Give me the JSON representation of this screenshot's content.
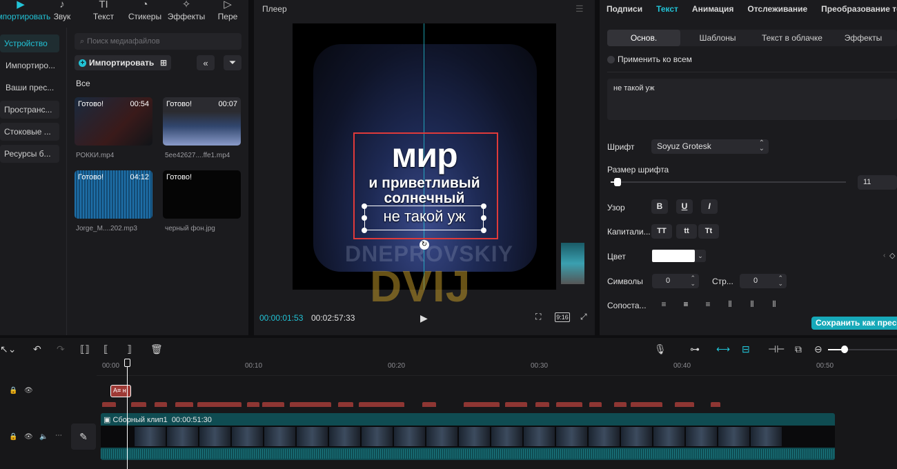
{
  "media_panel": {
    "categories": [
      {
        "label": "Импортировать",
        "icon": "▶"
      },
      {
        "label": "Звук",
        "icon": "♪"
      },
      {
        "label": "Текст",
        "icon": "TI"
      },
      {
        "label": "Стикеры",
        "icon": "◔"
      },
      {
        "label": "Эффекты",
        "icon": "✧"
      },
      {
        "label": "Пере",
        "icon": "▷"
      }
    ],
    "side_nav": [
      "Устройство",
      "Импортиро...",
      "Ваши прес...",
      "Пространс...",
      "Стоковые ...",
      "Ресурсы б..."
    ],
    "search_placeholder": "Поиск медиафайлов",
    "import_label": "Импортировать",
    "filter_label": "Все",
    "items": [
      {
        "status": "Готово!",
        "duration": "00:54",
        "name": "РОККИ.mp4"
      },
      {
        "status": "Готово!",
        "duration": "00:07",
        "name": "5ee42627....ffe1.mp4"
      },
      {
        "status": "Готово!",
        "duration": "04:12",
        "name": "Jorge_M....202.mp3"
      },
      {
        "status": "Готово!",
        "duration": "",
        "name": "черный фон.jpg"
      }
    ]
  },
  "player": {
    "title": "Плеер",
    "overlay_lines": [
      "мир",
      "и приветливый",
      "солнечный",
      "не такой уж"
    ],
    "watermark_top": "DNEPROVSKIY",
    "watermark_bottom": "DVIJ",
    "current_time": "00:00:01:53",
    "total_time": "00:02:57:33",
    "aspect_ratio": "9:16"
  },
  "properties": {
    "tabs": [
      "Подписи",
      "Текст",
      "Анимация",
      "Отслеживание",
      "Преобразование те"
    ],
    "active_tab": 1,
    "sub_tabs": [
      "Основ.",
      "Шаблоны",
      "Текст в облачке",
      "Эффекты"
    ],
    "apply_all": "Применить ко всем",
    "text_value": "не такой уж",
    "font_label": "Шрифт",
    "font_value": "Soyuz Grotesk",
    "size_label": "Размер шрифта",
    "size_value": "11",
    "size_fraction": 0.02,
    "pattern_label": "Узор",
    "style_buttons": [
      "B",
      "U",
      "I"
    ],
    "caps_label": "Капитали...",
    "caps_buttons": [
      "TT",
      "tt",
      "Tt"
    ],
    "color_label": "Цвет",
    "color_value": "#ffffff",
    "chars_label": "Символы",
    "chars_value": "0",
    "lines_label": "Стр...",
    "lines_value": "0",
    "align_label": "Сопоста...",
    "save_preset": "Сохранить как пресе"
  },
  "timeline": {
    "ruler": [
      "00:00",
      "00:10",
      "00:20",
      "00:30",
      "00:40",
      "00:50"
    ],
    "text_clip_label": "А≡ н",
    "main_clip_label": "Сборный клип1",
    "main_clip_duration": "00:00:51:30"
  }
}
